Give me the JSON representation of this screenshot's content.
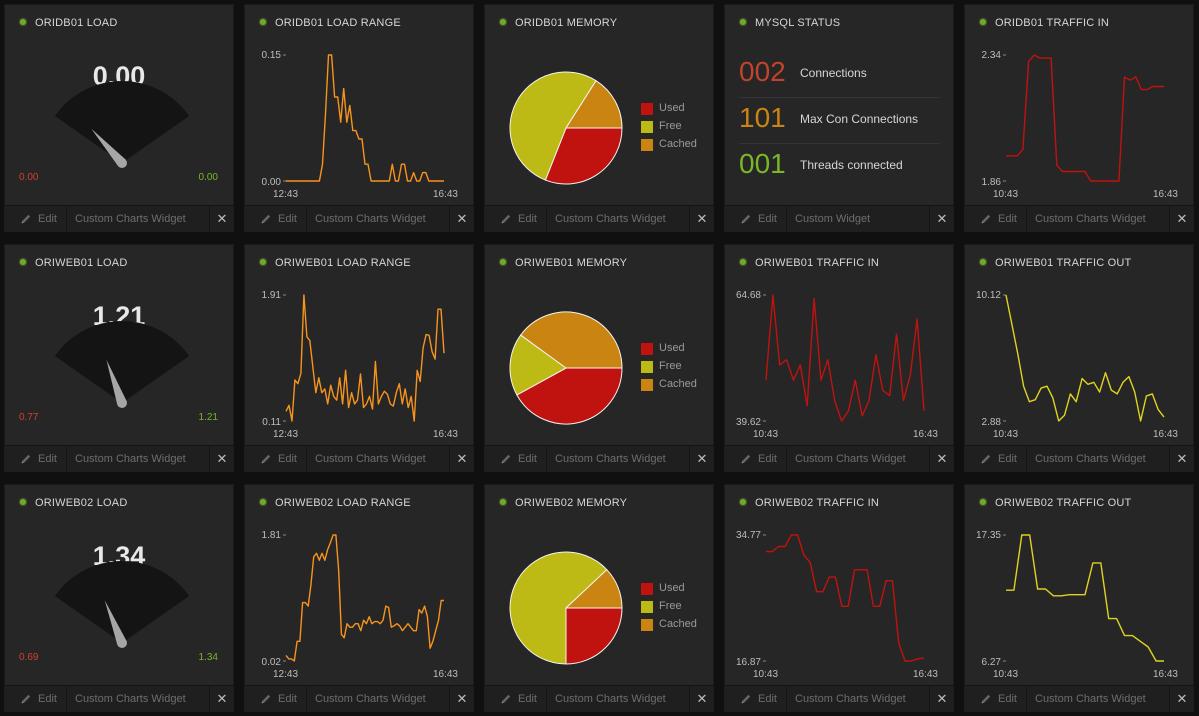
{
  "footer": {
    "edit_label": "Edit",
    "close_symbol": "✕"
  },
  "colors": {
    "used": "#c0130f",
    "free": "#bdb915",
    "cached": "#c98412",
    "load_line": "#f7941d",
    "traffic_in_line": "#c0130f",
    "traffic_out_line": "#e0d31f",
    "status_dot": "#6fa82b"
  },
  "rows": [
    {
      "gauge": {
        "title": "ORIDB01 LOAD",
        "value": "0.00",
        "min": "0.00",
        "max": "0.00",
        "fraction": 0.12,
        "widget_type": "Custom Charts Widget"
      },
      "load": {
        "title": "ORIDB01 LOAD RANGE",
        "ymax": "0.15",
        "ymin": "0.00",
        "xstart": "12:43",
        "xend": "16:43",
        "widget_type": "Custom Charts Widget",
        "values": [
          0,
          0,
          0,
          0,
          0,
          0,
          0,
          0,
          0,
          0,
          0,
          0,
          0.02,
          0.08,
          0.15,
          0.15,
          0.1,
          0.1,
          0.07,
          0.11,
          0.07,
          0.09,
          0.06,
          0.06,
          0.05,
          0.05,
          0.02,
          0.02,
          0,
          0,
          0,
          0,
          0,
          0,
          0,
          0.02,
          0,
          0,
          0.02,
          0.02,
          0,
          0,
          0.01,
          0,
          0,
          0.01,
          0.01,
          0,
          0,
          0,
          0,
          0,
          0
        ]
      },
      "memory": {
        "title": "ORIDB01 MEMORY",
        "used": 0.31,
        "free": 0.53,
        "cached": 0.16,
        "used_label": "Used",
        "free_label": "Free",
        "cached_label": "Cached",
        "widget_type": "Custom Charts Widget"
      },
      "fourth": {
        "kind": "mysql",
        "title": "MYSQL STATUS",
        "widget_type": "Custom Widget",
        "items": [
          {
            "value": "002",
            "label": "Connections",
            "color": "#c0432b"
          },
          {
            "value": "101",
            "label": "Max Con Connections",
            "color": "#c98412"
          },
          {
            "value": "001",
            "label": "Threads connected",
            "color": "#7ab628"
          }
        ]
      },
      "fifth": {
        "kind": "line",
        "title": "ORIDB01 TRAFFIC IN",
        "ymax": "2.34",
        "ymin": "1.86",
        "xstart": "10:43",
        "xend": "16:43",
        "color_key": "traffic_in_line",
        "widget_type": "Custom Charts Widget",
        "values": [
          2.0,
          2.0,
          2.0,
          2.02,
          2.3,
          2.32,
          2.31,
          2.31,
          2.31,
          1.97,
          1.95,
          1.95,
          1.95,
          1.95,
          1.95,
          1.92,
          1.92,
          1.92,
          1.92,
          1.92,
          1.92,
          2.25,
          2.24,
          2.25,
          2.21,
          2.21,
          2.22,
          2.22,
          2.22
        ]
      }
    },
    {
      "gauge": {
        "title": "ORIWEB01 LOAD",
        "value": "1.21",
        "min": "0.77",
        "max": "1.21",
        "fraction": 0.32,
        "widget_type": "Custom Charts Widget"
      },
      "load": {
        "title": "ORIWEB01 LOAD RANGE",
        "ymax": "1.91",
        "ymin": "0.11",
        "xstart": "12:43",
        "xend": "16:43",
        "widget_type": "Custom Charts Widget",
        "values": [
          0.35,
          0.43,
          0.22,
          0.77,
          0.72,
          0.86,
          1.91,
          1.35,
          1.3,
          0.95,
          0.6,
          0.8,
          0.6,
          0.65,
          0.45,
          0.7,
          0.55,
          0.5,
          0.8,
          0.45,
          0.9,
          0.4,
          0.6,
          0.45,
          0.5,
          0.85,
          0.4,
          0.45,
          0.55,
          0.38,
          1.02,
          0.45,
          0.55,
          0.62,
          0.58,
          0.45,
          0.42,
          0.6,
          0.72,
          0.45,
          0.65,
          0.4,
          0.55,
          0.22,
          0.9,
          0.75,
          1.2,
          1.38,
          1.37,
          1.15,
          1.05,
          1.72,
          1.72,
          1.13
        ]
      },
      "memory": {
        "title": "ORIWEB01 MEMORY",
        "used": 0.42,
        "free": 0.18,
        "cached": 0.4,
        "used_label": "Used",
        "free_label": "Free",
        "cached_label": "Cached",
        "widget_type": "Custom Charts Widget"
      },
      "fourth": {
        "kind": "line",
        "title": "ORIWEB01 TRAFFIC IN",
        "ymax": "64.68",
        "ymin": "39.62",
        "xstart": "10:43",
        "xend": "16:43",
        "color_key": "traffic_in_line",
        "widget_type": "Custom Charts Widget",
        "values": [
          48,
          64.7,
          51,
          52,
          48,
          51,
          43,
          64,
          48,
          52,
          44,
          40,
          42,
          48,
          41,
          44,
          53,
          46,
          45,
          57,
          44,
          49,
          60,
          42
        ]
      },
      "fifth": {
        "kind": "line",
        "title": "ORIWEB01 TRAFFIC OUT",
        "ymax": "10.12",
        "ymin": "2.88",
        "xstart": "10:43",
        "xend": "16:43",
        "color_key": "traffic_out_line",
        "widget_type": "Custom Charts Widget",
        "values": [
          10.12,
          8.6,
          7.1,
          5.4,
          4.6,
          4.7,
          5.3,
          5.4,
          4.8,
          3.6,
          3.9,
          5.0,
          4.6,
          5.8,
          5.5,
          5.6,
          5.1,
          6.1,
          5.2,
          5.0,
          5.6,
          5.9,
          5.1,
          3.6,
          4.9,
          5.0,
          4.2,
          3.8
        ]
      }
    },
    {
      "gauge": {
        "title": "ORIWEB02 LOAD",
        "value": "1.34",
        "min": "0.69",
        "max": "1.34",
        "fraction": 0.3,
        "widget_type": "Custom Charts Widget"
      },
      "load": {
        "title": "ORIWEB02 LOAD RANGE",
        "ymax": "1.81",
        "ymin": "0.02",
        "xstart": "12:43",
        "xend": "16:43",
        "widget_type": "Custom Charts Widget",
        "values": [
          0.1,
          0.05,
          0.05,
          0.02,
          0.3,
          0.3,
          0.85,
          0.85,
          0.8,
          1.1,
          1.5,
          1.55,
          1.45,
          1.55,
          1.45,
          1.6,
          1.7,
          1.81,
          1.81,
          1.3,
          0.4,
          0.35,
          0.55,
          0.5,
          0.5,
          0.55,
          0.55,
          0.45,
          0.6,
          0.55,
          0.65,
          0.55,
          0.58,
          0.58,
          0.55,
          0.6,
          0.8,
          0.78,
          0.5,
          0.52,
          0.55,
          0.52,
          0.45,
          0.5,
          0.55,
          0.5,
          0.45,
          0.45,
          0.75,
          0.7,
          0.8,
          0.65,
          0.2,
          0.3,
          0.45,
          0.6,
          0.88,
          0.88
        ]
      },
      "memory": {
        "title": "ORIWEB02 MEMORY",
        "used": 0.25,
        "free": 0.63,
        "cached": 0.12,
        "used_label": "Used",
        "free_label": "Free",
        "cached_label": "Cached",
        "widget_type": "Custom Charts Widget"
      },
      "fourth": {
        "kind": "line",
        "title": "ORIWEB02 TRAFFIC IN",
        "ymax": "34.77",
        "ymin": "16.87",
        "xstart": "10:43",
        "xend": "16:43",
        "color_key": "traffic_in_line",
        "widget_type": "Custom Charts Widget",
        "values": [
          32.5,
          32.5,
          33.2,
          33.2,
          34.77,
          34.77,
          32,
          31,
          27,
          27,
          29,
          29,
          25,
          25,
          30,
          30,
          30,
          25,
          25,
          28.5,
          28.5,
          20,
          17.5,
          17.5,
          17.8,
          17.9
        ]
      },
      "fifth": {
        "kind": "line",
        "title": "ORIWEB02 TRAFFIC OUT",
        "ymax": "17.35",
        "ymin": "6.27",
        "xstart": "10:43",
        "xend": "16:43",
        "color_key": "traffic_out_line",
        "widget_type": "Custom Charts Widget",
        "values": [
          12.5,
          12.5,
          17.35,
          17.35,
          12.6,
          12.6,
          12,
          12,
          12.1,
          12.1,
          12.1,
          14.9,
          14.9,
          10,
          10,
          8.5,
          8.5,
          8,
          7.5,
          6.27,
          6.27
        ]
      }
    }
  ]
}
